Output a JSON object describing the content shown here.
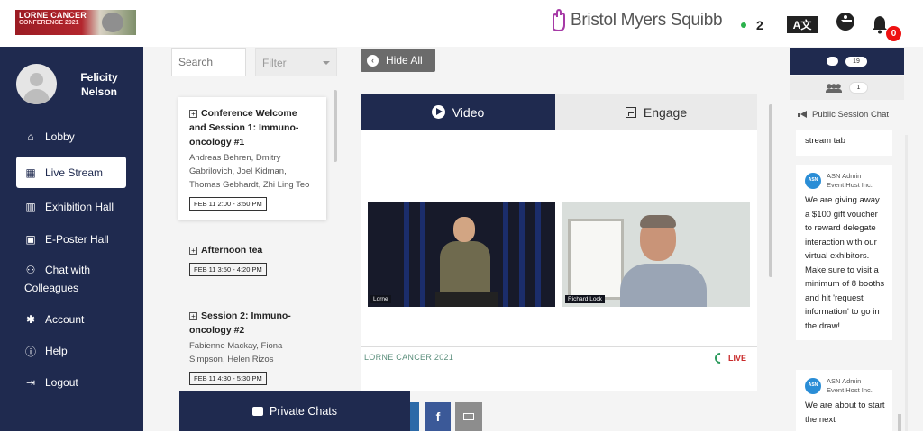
{
  "header": {
    "event_logo_line1": "LORNE CANCER",
    "event_logo_line2": "CONFERENCE 2021",
    "sponsor": "Bristol Myers Squibb",
    "online_count": "2",
    "translate_label": "A文",
    "notification_count": "0"
  },
  "user": {
    "name": "Felicity Nelson"
  },
  "nav": [
    {
      "label": "Lobby",
      "icon": "home-icon"
    },
    {
      "label": "Live Stream",
      "icon": "calendar-icon",
      "active": true
    },
    {
      "label": "Exhibition Hall",
      "icon": "building-icon"
    },
    {
      "label": "E-Poster Hall",
      "icon": "poster-icon"
    },
    {
      "label": "Chat with Colleagues",
      "icon": "users-icon"
    },
    {
      "label": "Account",
      "icon": "gear-icon"
    },
    {
      "label": "Help",
      "icon": "info-icon"
    },
    {
      "label": "Logout",
      "icon": "logout-icon"
    }
  ],
  "sessions_panel": {
    "search_placeholder": "Search",
    "filter_label": "Filter",
    "sessions": [
      {
        "title": "Conference Welcome and Session 1: Immuno-oncology #1",
        "speakers": "Andreas Behren, Dmitry Gabrilovich, Joel Kidman, Thomas Gebhardt, Zhi Ling Teo",
        "time": "FEB 11 2:00 - 3:50 PM"
      },
      {
        "title": "Afternoon tea",
        "speakers": "",
        "time": "FEB 11 3:50 - 4:20 PM"
      },
      {
        "title": "Session 2: Immuno-oncology #2",
        "speakers": "Fabienne Mackay, Fiona Simpson, Helen Rizos",
        "time": "FEB 11 4:30 - 5:30 PM"
      }
    ],
    "private_chats_label": "Private Chats"
  },
  "main": {
    "hide_all_label": "Hide All",
    "tabs": [
      {
        "label": "Video"
      },
      {
        "label": "Engage"
      }
    ],
    "video_feeds": [
      {
        "label": "Lorne"
      },
      {
        "label": "Richard Lock"
      }
    ],
    "brand_strip_text": "LORNE CANCER 2021",
    "live_label": "LIVE",
    "share_facebook": "f"
  },
  "chat": {
    "message_count": "19",
    "people_count": "1",
    "title": "Public Session Chat",
    "messages": [
      {
        "sender": "",
        "role": "",
        "text": "stream tab"
      },
      {
        "sender": "ASN Admin",
        "role": "Event Host Inc.",
        "text": "We are giving away a $100 gift voucher to reward delegate interaction with our virtual exhibitors. Make sure to visit a minimum of 8 booths and hit 'request information' to go in the draw!"
      },
      {
        "sender": "ASN Admin",
        "role": "Event Host Inc.",
        "text": "We are about to start the next"
      }
    ],
    "avatar_text": "ASN"
  }
}
